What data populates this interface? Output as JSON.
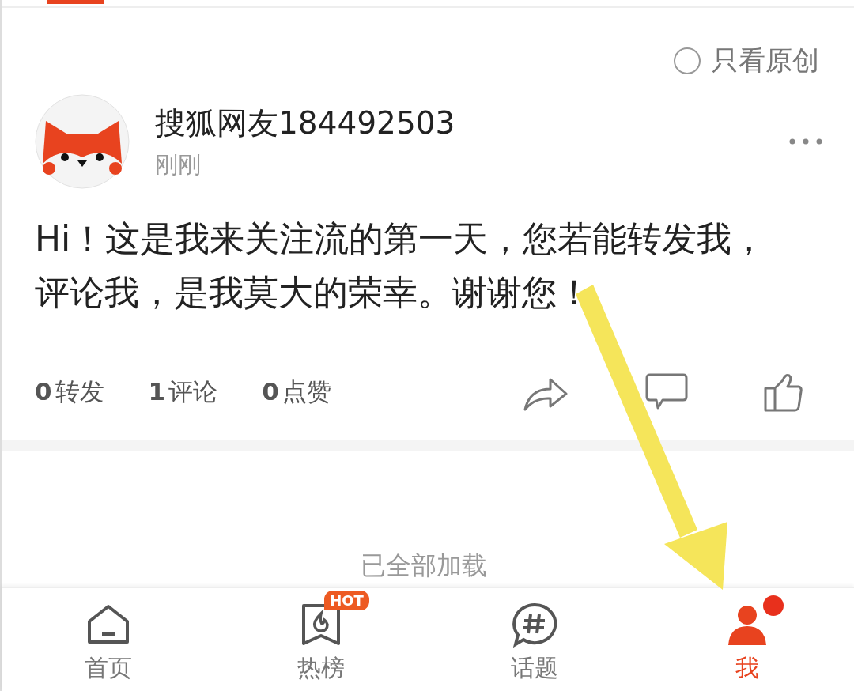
{
  "filter": {
    "label": "只看原创",
    "checked": false
  },
  "post": {
    "author": "搜狐网友184492503",
    "time": "刚刚",
    "text": "Hi！这是我来关注流的第一天，您若能转发我，评论我，是我莫大的荣幸。谢谢您！",
    "stats": [
      {
        "count": "0",
        "label": "转发"
      },
      {
        "count": "1",
        "label": "评论"
      },
      {
        "count": "0",
        "label": "点赞"
      }
    ],
    "actions": [
      {
        "kind": "share"
      },
      {
        "kind": "comment"
      },
      {
        "kind": "like"
      }
    ]
  },
  "footer": "已全部加载",
  "nav": [
    {
      "label": "首页",
      "kind": "home",
      "selected": false
    },
    {
      "label": "热榜",
      "kind": "hot",
      "selected": false,
      "badge": "HOT"
    },
    {
      "label": "话题",
      "kind": "topic",
      "selected": false
    },
    {
      "label": "我",
      "kind": "me",
      "selected": true,
      "dot": true
    }
  ]
}
